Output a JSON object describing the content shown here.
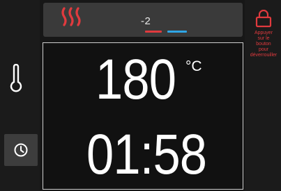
{
  "colors": {
    "accent_red": "#e03a3e",
    "accent_blue": "#2fa6e6",
    "text": "#ffffff",
    "panel": "#3a3a3a",
    "background": "#151515"
  },
  "icons": {
    "heat": "heat-waves-icon",
    "thermometer": "thermometer-icon",
    "timer": "clock-icon",
    "lock": "lock-icon"
  },
  "heat_level": {
    "value": "-2"
  },
  "display": {
    "temperature": "180",
    "temperature_unit": "°C",
    "time": "01:58"
  },
  "lock": {
    "line1": "Appuyer",
    "line2": "sur le",
    "line3": "bouton",
    "line4": "pour",
    "line5": "déverrouiller"
  }
}
